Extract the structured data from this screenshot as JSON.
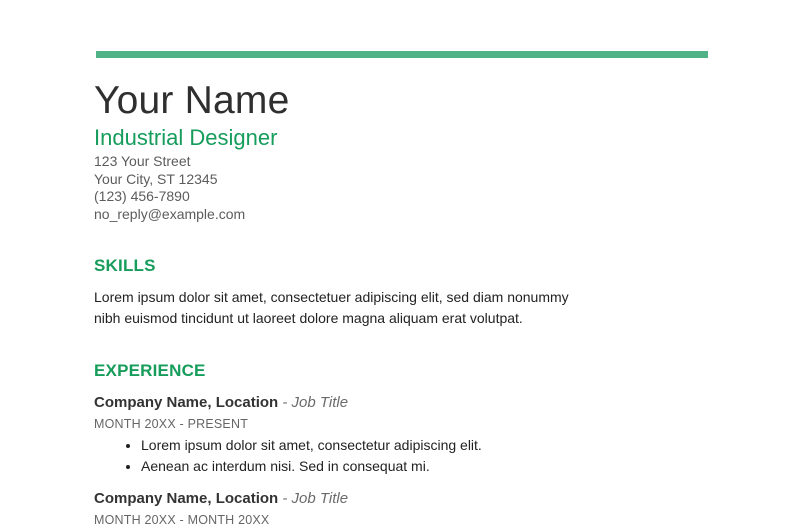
{
  "header": {
    "name": "Your Name",
    "role": "Industrial Designer",
    "contact": [
      "123 Your Street",
      "Your City, ST 12345",
      "(123) 456-7890",
      "no_reply@example.com"
    ]
  },
  "skills": {
    "title": "SKILLS",
    "text": "Lorem ipsum dolor sit amet, consectetuer adipiscing elit, sed diam nonummy nibh euismod tincidunt ut laoreet dolore magna aliquam erat volutpat."
  },
  "experience": {
    "title": "EXPERIENCE",
    "jobs": [
      {
        "company": "Company Name,  Location",
        "separator": " - ",
        "title": "Job Title",
        "dates": "MONTH 20XX - PRESENT",
        "bullets": [
          "Lorem ipsum dolor sit amet, consectetur adipiscing elit.",
          "Aenean ac interdum nisi. Sed in consequat mi."
        ]
      },
      {
        "company": "Company Name, Location",
        "separator": " - ",
        "title": "Job Title",
        "dates": "MONTH 20XX - MONTH 20XX",
        "bullets": []
      }
    ]
  },
  "colors": {
    "accent": "#169c5b",
    "rule": "#4fb387",
    "text": "#222222"
  }
}
